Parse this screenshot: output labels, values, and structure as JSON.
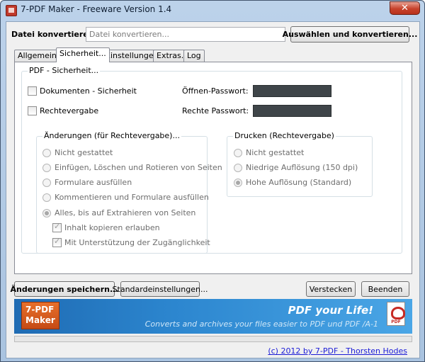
{
  "window": {
    "title": "7-PDF Maker - Freeware Version 1.4",
    "close_glyph": "✕"
  },
  "convert": {
    "label": "Datei konvertieren:",
    "placeholder": "Datei konvertieren...",
    "select_button": "Auswählen und konvertieren..."
  },
  "tabs": [
    {
      "label": "Allgemein..."
    },
    {
      "label": "Sicherheit..."
    },
    {
      "label": "Einstellungen..."
    },
    {
      "label": "Extras..."
    },
    {
      "label": "Log"
    }
  ],
  "active_tab_index": 1,
  "security": {
    "group_title": "PDF - Sicherheit...",
    "doc_security_label": "Dokumenten - Sicherheit",
    "rights_label": "Rechtevergabe",
    "open_password_label": "Öffnen-Passwort:",
    "rights_password_label": "Rechte Passwort:"
  },
  "changes": {
    "group_title": "Änderungen (für Rechtevergabe)...",
    "options": [
      {
        "label": "Nicht gestattet",
        "checked": false
      },
      {
        "label": "Einfügen, Löschen und Rotieren von Seiten",
        "checked": false
      },
      {
        "label": "Formulare ausfüllen",
        "checked": false
      },
      {
        "label": "Kommentieren und Formulare ausfüllen",
        "checked": false
      },
      {
        "label": "Alles, bis auf Extrahieren von Seiten",
        "checked": true
      }
    ],
    "sub_checks": [
      {
        "label": "Inhalt kopieren erlauben",
        "checked": true
      },
      {
        "label": "Mit Unterstützung der Zugänglichkeit",
        "checked": true
      }
    ]
  },
  "print": {
    "group_title": "Drucken (Rechtevergabe)",
    "options": [
      {
        "label": "Nicht gestattet",
        "checked": false
      },
      {
        "label": "Niedrige Auflösung (150 dpi)",
        "checked": false
      },
      {
        "label": "Hohe Auflösung (Standard)",
        "checked": true
      }
    ]
  },
  "buttons": {
    "save": "Änderungen speichern...",
    "defaults": "Standardeinstellungen...",
    "hide": "Verstecken",
    "quit": "Beenden"
  },
  "banner": {
    "logo_line1": "7-PDF",
    "logo_line2": "Maker",
    "slogan": "PDF your Life!",
    "subtitle": "Converts and archives your files easier to PDF und PDF /A-1",
    "icon_text": "PDF"
  },
  "footer": {
    "copyright": "(c) 2012 by 7-PDF - Thorsten Hodes"
  },
  "colors": {
    "accent": "#2c86cf",
    "close_button": "#c7422b",
    "password_field": "#3f4549"
  }
}
